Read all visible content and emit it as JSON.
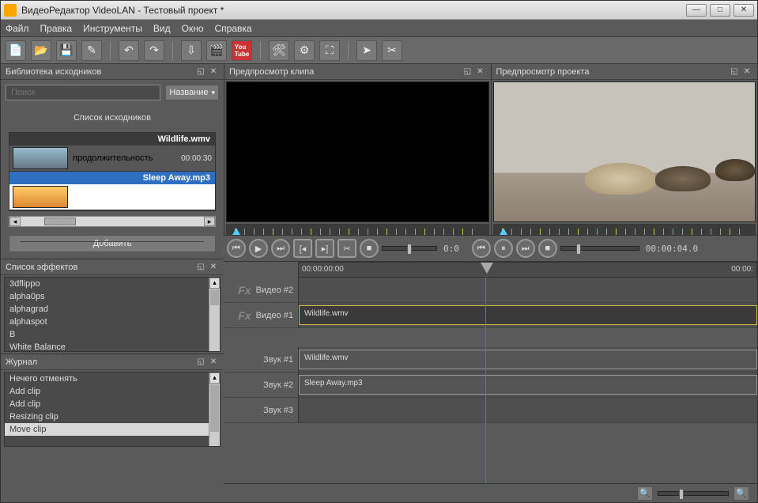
{
  "window": {
    "title": "ВидеоРедактор VideoLAN - Тестовый проект *"
  },
  "menu": {
    "file": "Файл",
    "edit": "Правка",
    "tools": "Инструменты",
    "view": "Вид",
    "window": "Окно",
    "help": "Справка"
  },
  "panels": {
    "library": "Библиотека исходников",
    "clip_preview": "Предпросмотр клипа",
    "project_preview": "Предпросмотр проекта",
    "effects": "Список эффектов",
    "journal": "Журнал"
  },
  "library": {
    "search_placeholder": "Поиск",
    "sort": "Название",
    "caption": "Список исходников",
    "add": "Добавить",
    "items": [
      {
        "name": "Wildlife.wmv",
        "meta_label": "продолжительность",
        "duration": "00:00:30"
      },
      {
        "name": "Sleep Away.mp3"
      }
    ]
  },
  "effects": {
    "items": [
      "3dflippo",
      "alpha0ps",
      "alphagrad",
      "alphaspot",
      "B",
      "White Balance"
    ]
  },
  "journal": {
    "items": [
      "Нечего отменять",
      "Add clip",
      "Add clip",
      "Resizing clip",
      "Move clip"
    ],
    "selected_index": 4
  },
  "controls": {
    "time_left": "0:0",
    "time_right": "00:00:04.0"
  },
  "timeline": {
    "start": "00:00:00:00",
    "end": "00:00:",
    "tracks": {
      "video2": "Видео #2",
      "video1": "Видео #1",
      "audio1": "Звук #1",
      "audio2": "Звук #2",
      "audio3": "Звук #3"
    },
    "clips": {
      "v1": "Wildlife.wmv",
      "a1": "Wildlife.wmv",
      "a2": "Sleep Away.mp3"
    }
  }
}
